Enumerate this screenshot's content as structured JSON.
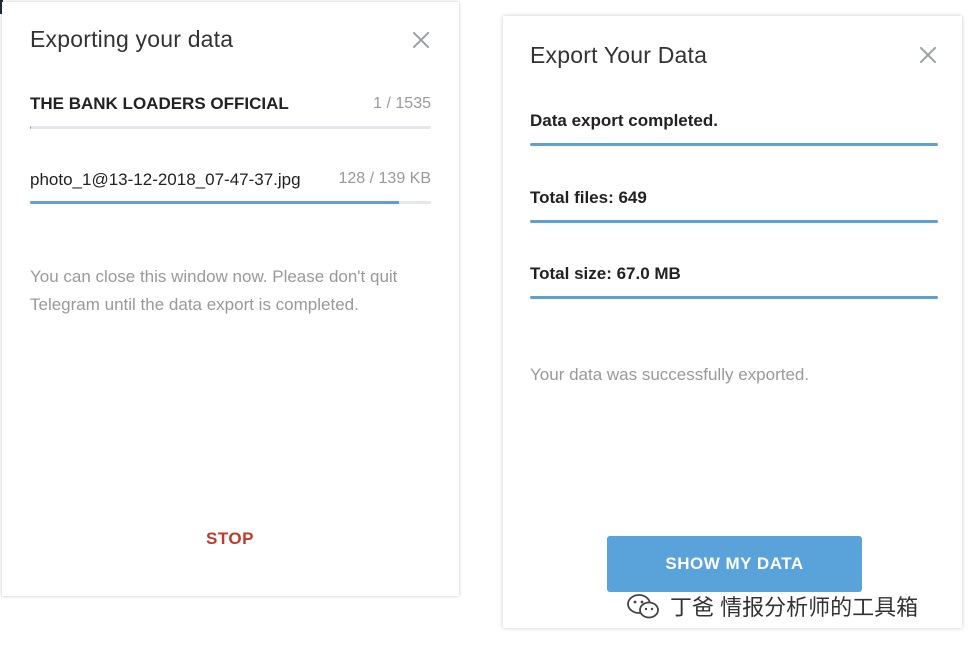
{
  "left": {
    "title": "Exporting your data",
    "current_chat": "THE BANK LOADERS OFFICIAL",
    "chat_progress": "1 / 1535",
    "chat_progress_fraction": 0.001,
    "current_file": "photo_1@13-12-2018_07-47-37.jpg",
    "file_progress": "128 / 139 KB",
    "file_progress_fraction": 0.92,
    "note": "You can close this window now. Please don't quit Telegram until the data export is completed.",
    "stop_label": "STOP"
  },
  "right": {
    "title": "Export Your Data",
    "status": "Data export completed.",
    "total_files": "Total files: 649",
    "total_size": "Total size: 67.0 MB",
    "message": "Your data was successfully exported.",
    "show_button": "SHOW MY DATA"
  },
  "watermark": {
    "text": "丁爸 情报分析师的工具箱"
  },
  "colors": {
    "accent": "#5aa2da",
    "stop": "#c0392b"
  }
}
